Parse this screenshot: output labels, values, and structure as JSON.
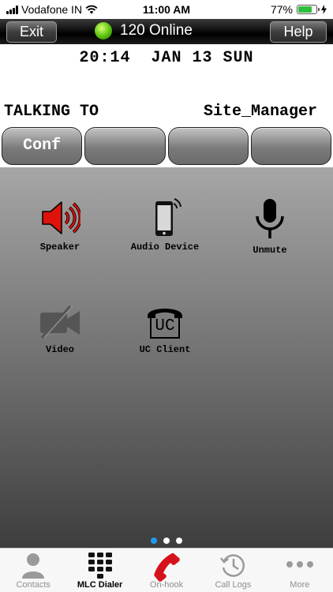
{
  "status_bar": {
    "carrier": "Vodafone IN",
    "time": "11:00 AM",
    "battery": "77%",
    "battery_level": 0.77
  },
  "toolbar": {
    "exit_label": "Exit",
    "online_text": "120 Online",
    "help_label": "Help"
  },
  "display": {
    "datetime": "20:14  JAN 13 SUN",
    "talking_label": "TALKING TO",
    "talking_name": "Site_Manager"
  },
  "softkeys": [
    "Conf",
    "",
    "",
    ""
  ],
  "actions": {
    "speaker": "Speaker",
    "audio_device": "Audio Device",
    "unmute": "Unmute",
    "video": "Video",
    "uc_client": "UC Client",
    "uc_badge": "UC"
  },
  "page_indicator": {
    "pages": 3,
    "current": 1
  },
  "tabs": {
    "contacts": "Contacts",
    "mlc_dialer": "MLC Dialer",
    "on_hook": "On-hook",
    "call_logs": "Call Logs",
    "more": "More",
    "active": "mlc_dialer"
  },
  "colors": {
    "speaker_active": "#e0120c",
    "online_led": "#57c10d",
    "page_dot_active": "#1e9bf0",
    "on_hook_icon": "#d5121b"
  }
}
